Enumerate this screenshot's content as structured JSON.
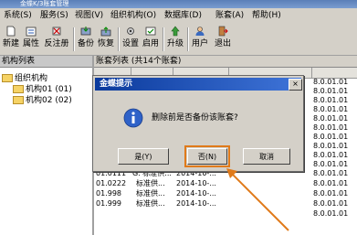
{
  "window": {
    "title": "金蝶K/3账套管理"
  },
  "menu": [
    {
      "label": "系统(S)"
    },
    {
      "label": "服务(S)"
    },
    {
      "label": "视图(V)"
    },
    {
      "label": "组织机构(O)"
    },
    {
      "label": "数据库(D)"
    },
    {
      "label": "账套(A)"
    },
    {
      "label": "帮助(H)"
    }
  ],
  "toolbar": [
    {
      "label": "新建",
      "icon": "new-icon"
    },
    {
      "label": "属性",
      "icon": "properties-icon"
    },
    {
      "label": "反注册",
      "icon": "unregister-icon"
    },
    {
      "label": "备份",
      "icon": "backup-icon"
    },
    {
      "label": "恢复",
      "icon": "restore-icon"
    },
    {
      "label": "设置",
      "icon": "settings-icon"
    },
    {
      "label": "启用",
      "icon": "enable-icon"
    },
    {
      "label": "升级",
      "icon": "upgrade-icon"
    },
    {
      "label": "用户",
      "icon": "user-icon"
    },
    {
      "label": "退出",
      "icon": "exit-icon"
    }
  ],
  "left_pane": {
    "header": "机构列表",
    "tree": [
      {
        "label": "组织机构"
      },
      {
        "label": "机构01 (01)"
      },
      {
        "label": "机构02 (02)"
      }
    ]
  },
  "right_pane": {
    "header": "账套列表 (共14个账套)",
    "rows": [
      {
        "code": "01.0111",
        "name": "G. 标准供...",
        "date": "2014-10-...",
        "version": "8.0.01.01"
      },
      {
        "code": "01.0222",
        "name": "标准供...",
        "date": "2014-10-...",
        "version": "8.0.01.01"
      },
      {
        "code": "01.998",
        "name": "标准供...",
        "date": "2014-10-...",
        "version": "8.0.01.01"
      },
      {
        "code": "01.999",
        "name": "标准供...",
        "date": "2014-10-...",
        "version": "8.0.01.01"
      }
    ],
    "version_column": [
      "8.0.01.01",
      "8.0.01.01",
      "8.0.01.01",
      "8.0.01.01",
      "8.0.01.01",
      "8.0.01.01",
      "8.0.01.01",
      "8.0.01.01",
      "8.0.01.01",
      "8.0.01.01",
      "8.0.01.01",
      "8.0.01.01",
      "8.0.01.01",
      "8.0.01.01",
      "8.0.01.01"
    ]
  },
  "dialog": {
    "title": "金蝶提示",
    "close": "×",
    "icon": "info-icon",
    "message": "删除前是否备份该账套?",
    "buttons": {
      "yes": "是(Y)",
      "no": "否(N)",
      "cancel": "取消"
    }
  },
  "colors": {
    "accent": "#e07a1a",
    "dialog_title": "#0b3a9c"
  }
}
